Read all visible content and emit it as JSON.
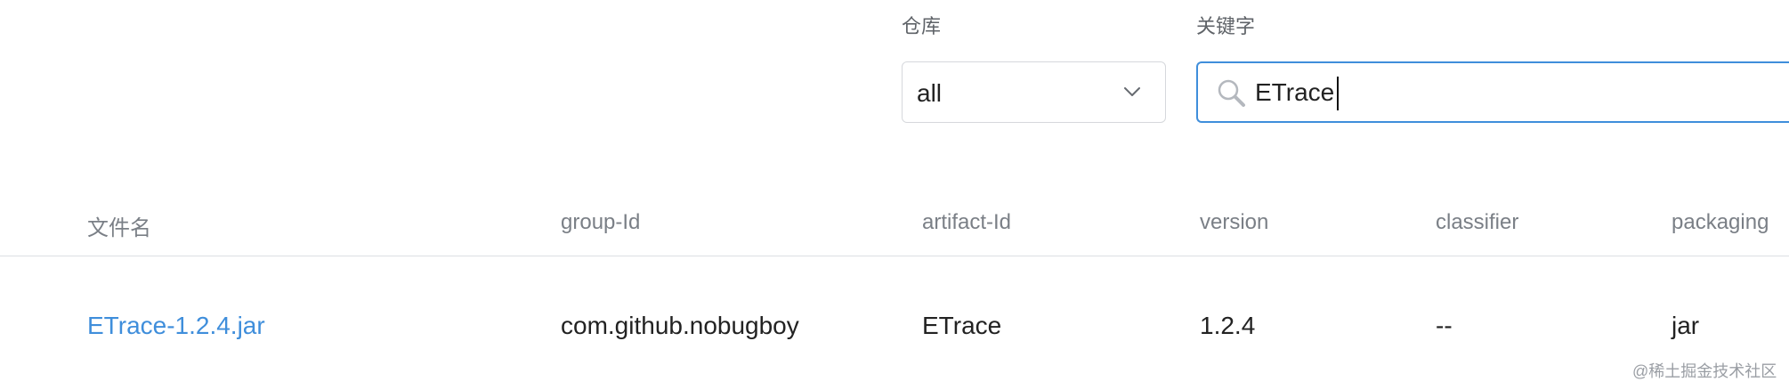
{
  "filters": {
    "repository_label": "仓库",
    "repository_value": "all",
    "keyword_label": "关键字",
    "keyword_value": "ETrace"
  },
  "table": {
    "columns": [
      "文件名",
      "group-Id",
      "artifact-Id",
      "version",
      "classifier",
      "packaging"
    ],
    "rows": [
      {
        "filename": "ETrace-1.2.4.jar",
        "group_id": "com.github.nobugboy",
        "artifact_id": "ETrace",
        "version": "1.2.4",
        "classifier": "--",
        "packaging": "jar"
      }
    ]
  },
  "watermark": "@稀土掘金技术社区",
  "colors": {
    "link": "#3f8edb",
    "focus_border": "#3f8edb",
    "header_text": "#7a7f86",
    "divider": "#dcdfe3"
  },
  "icons": {
    "select_arrow": "chevron-down-icon",
    "search": "search-icon"
  }
}
